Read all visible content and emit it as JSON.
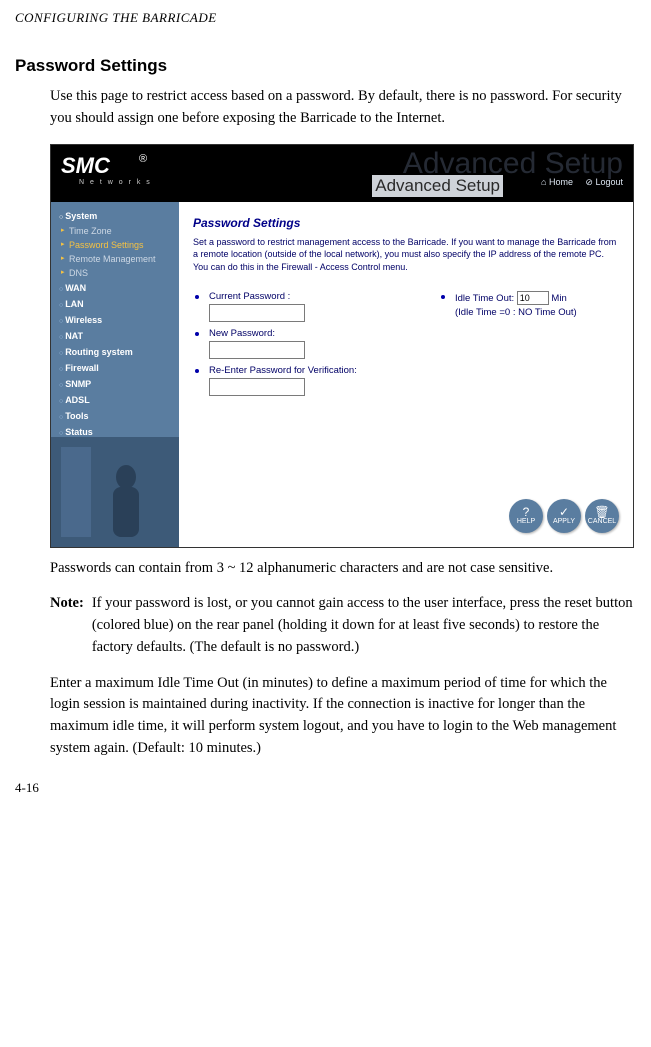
{
  "running_header": "CONFIGURING THE BARRICADE",
  "section_title": "Password Settings",
  "intro_para": "Use this page to restrict access based on a password. By default, there is no password. For security you should assign one before exposing the Barricade to the Internet.",
  "after_shot": "Passwords can contain from 3 ~ 12 alphanumeric characters and are not case sensitive.",
  "note_label": "Note:",
  "note_text": "If your password is lost, or you cannot gain access to the user interface, press the reset button (colored blue) on the rear panel (holding it down for at least five seconds) to restore the factory defaults. (The default is no password.)",
  "idle_para": "Enter a maximum Idle Time Out (in minutes) to define a maximum period of time for which the login session is maintained during inactivity. If the connection is inactive for longer than the maximum idle time, it will perform system logout, and you have to login to the Web management system again. (Default: 10 minutes.)",
  "page_number": "4-16",
  "screenshot": {
    "logo_main": "SMC",
    "logo_sub": "N e t w o r k s",
    "logo_r": "®",
    "title_ghost": "Advanced Setup",
    "title": "Advanced Setup",
    "toplinks": {
      "home": "Home",
      "logout": "Logout"
    },
    "nav": {
      "system": "System",
      "sub": {
        "timezone": "Time Zone",
        "password": "Password Settings",
        "remote": "Remote Management",
        "dns": "DNS"
      },
      "wan": "WAN",
      "lan": "LAN",
      "wireless": "Wireless",
      "nat": "NAT",
      "routing": "Routing system",
      "firewall": "Firewall",
      "snmp": "SNMP",
      "adsl": "ADSL",
      "tools": "Tools",
      "status": "Status"
    },
    "content": {
      "heading": "Password Settings",
      "desc": "Set a password to restrict management access to the Barricade. If you want to manage the Barricade from a remote location (outside of the local network), you must also specify the IP address of the remote PC. You can do this in the Firewall - Access Control menu.",
      "current_pw": "Current Password :",
      "new_pw": "New Password:",
      "verify_pw": "Re-Enter Password for Verification:",
      "idle_label": "Idle Time Out:",
      "idle_value": "10",
      "idle_unit": "Min",
      "idle_hint": "(Idle Time =0 : NO Time Out)"
    },
    "buttons": {
      "help": "HELP",
      "apply": "APPLY",
      "cancel": "CANCEL"
    }
  }
}
